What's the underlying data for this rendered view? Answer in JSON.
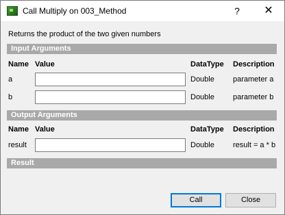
{
  "window": {
    "title": "Call Multiply on 003_Method",
    "help_glyph": "?",
    "close_glyph": "✕"
  },
  "description": "Returns the product of the two given numbers",
  "input_section": {
    "title": "Input Arguments",
    "headers": {
      "name": "Name",
      "value": "Value",
      "datatype": "DataType",
      "description": "Description"
    },
    "rows": [
      {
        "name": "a",
        "value": "",
        "datatype": "Double",
        "description": "parameter a"
      },
      {
        "name": "b",
        "value": "",
        "datatype": "Double",
        "description": "parameter b"
      }
    ]
  },
  "output_section": {
    "title": "Output Arguments",
    "headers": {
      "name": "Name",
      "value": "Value",
      "datatype": "DataType",
      "description": "Description"
    },
    "rows": [
      {
        "name": "result",
        "value": "",
        "datatype": "Double",
        "description": "result = a * b"
      }
    ]
  },
  "result_section": {
    "title": "Result"
  },
  "buttons": {
    "call": "Call",
    "close": "Close"
  }
}
